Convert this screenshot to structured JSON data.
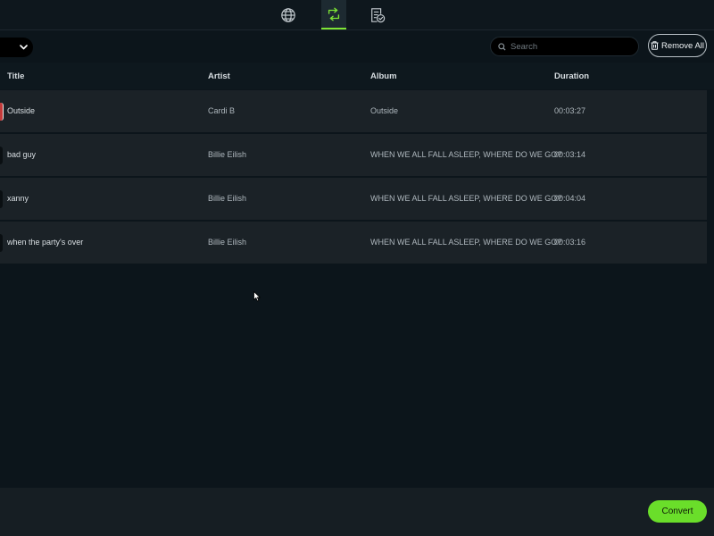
{
  "nav": {
    "tabs": [
      {
        "icon": "globe-icon",
        "active": false
      },
      {
        "icon": "convert-icon",
        "active": true
      },
      {
        "icon": "converted-list-icon",
        "active": false
      }
    ]
  },
  "toolbar": {
    "dropdown_icon": "chevron-down-icon",
    "search_placeholder": "Search",
    "search_value": "",
    "remove_all_label": "Remove All"
  },
  "table": {
    "columns": [
      "Title",
      "Artist",
      "Album",
      "Duration"
    ],
    "rows": [
      {
        "title": "Outside",
        "artist": "Cardi B",
        "album": "Outside",
        "duration": "00:03:27"
      },
      {
        "title": "bad guy",
        "artist": "Billie Eilish",
        "album": "WHEN WE ALL FALL ASLEEP, WHERE DO WE GO?",
        "duration": "00:03:14"
      },
      {
        "title": "xanny",
        "artist": "Billie Eilish",
        "album": "WHEN WE ALL FALL ASLEEP, WHERE DO WE GO?",
        "duration": "00:04:04"
      },
      {
        "title": "when the party's over",
        "artist": "Billie Eilish",
        "album": "WHEN WE ALL FALL ASLEEP, WHERE DO WE GO?",
        "duration": "00:03:16"
      }
    ]
  },
  "footer": {
    "convert_label": "Convert"
  },
  "colors": {
    "accent": "#6ade2a",
    "background": "#0c151b",
    "row": "#1b2227"
  }
}
